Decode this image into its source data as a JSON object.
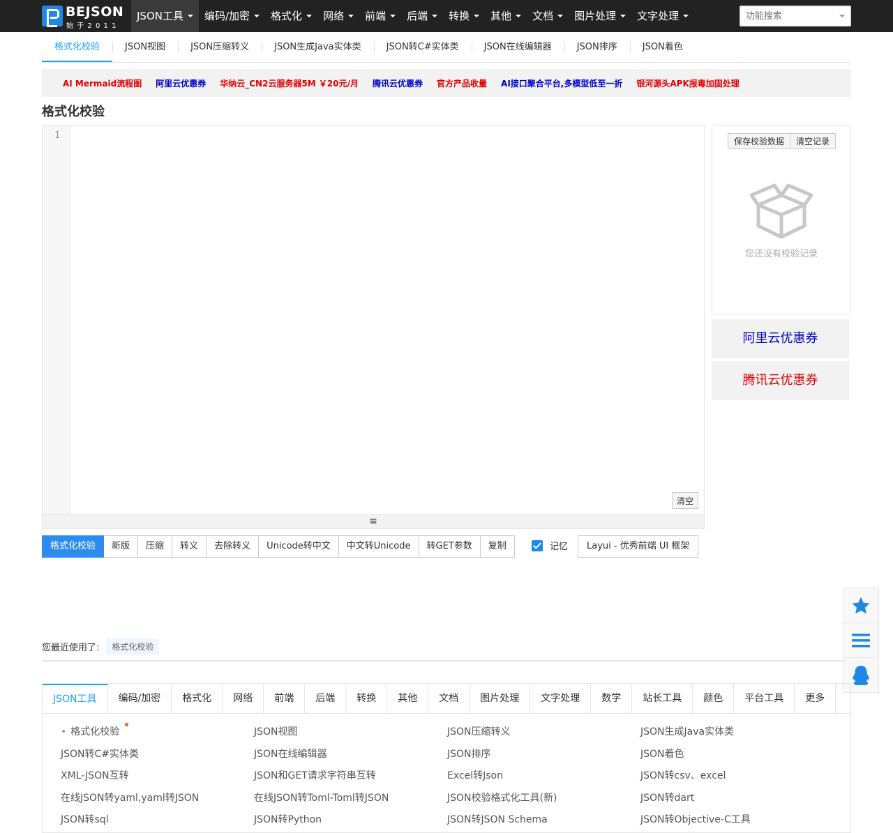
{
  "brand": {
    "name": "BEJSON",
    "since": "始于2011"
  },
  "nav": {
    "items": [
      {
        "label": "JSON工具",
        "active": true
      },
      {
        "label": "编码/加密"
      },
      {
        "label": "格式化"
      },
      {
        "label": "网络"
      },
      {
        "label": "前端"
      },
      {
        "label": "后端"
      },
      {
        "label": "转换"
      },
      {
        "label": "其他"
      },
      {
        "label": "文档"
      },
      {
        "label": "图片处理"
      },
      {
        "label": "文字处理"
      }
    ],
    "search_placeholder": "功能搜索"
  },
  "subtabs": [
    "格式化校验",
    "JSON视图",
    "JSON压缩转义",
    "JSON生成Java实体类",
    "JSON转C#实体类",
    "JSON在线编辑器",
    "JSON排序",
    "JSON着色"
  ],
  "ads": [
    {
      "label": "AI Mermaid流程图",
      "color": "red"
    },
    {
      "label": "阿里云优惠券",
      "color": "blue"
    },
    {
      "label": "华纳云_CN2云服务器5M ￥20元/月",
      "color": "red"
    },
    {
      "label": "腾讯云优惠券",
      "color": "blue"
    },
    {
      "label": "官方产品收量",
      "color": "red"
    },
    {
      "label": "AI接口聚合平台,多模型低至一折",
      "color": "blue"
    },
    {
      "label": "银河源头APK报毒加固处理",
      "color": "red"
    }
  ],
  "page_title": "格式化校验",
  "editor": {
    "line_number": "1",
    "clear_label": "清空"
  },
  "history": {
    "save_label": "保存校验数据",
    "clear_label": "清空记录",
    "empty_text": "您还没有校验记录"
  },
  "promos": [
    {
      "label": "阿里云优惠券",
      "color": "#0000c8"
    },
    {
      "label": "腾讯云优惠券",
      "color": "#e10000"
    }
  ],
  "actions": [
    "格式化校验",
    "新版",
    "压缩",
    "转义",
    "去除转义",
    "Unicode转中文",
    "中文转Unicode",
    "转GET参数",
    "复制"
  ],
  "memory_label": "记忆",
  "layui_label": "Layui - 优秀前端 UI 框架",
  "recent": {
    "label": "您最近使用了:",
    "items": [
      "格式化校验"
    ]
  },
  "category_tabs": [
    "JSON工具",
    "编码/加密",
    "格式化",
    "网络",
    "前端",
    "后端",
    "转换",
    "其他",
    "文档",
    "图片处理",
    "文字处理",
    "数学",
    "站长工具",
    "颜色",
    "平台工具",
    "更多"
  ],
  "tool_links": [
    "格式化校验",
    "JSON视图",
    "JSON压缩转义",
    "JSON生成Java实体类",
    "JSON转C#实体类",
    "JSON在线编辑器",
    "JSON排序",
    "JSON着色",
    "XML-JSON互转",
    "JSON和GET请求字符串互转",
    "Excel转Json",
    "JSON转csv、excel",
    "在线JSON转yaml,yaml转JSON",
    "在线JSON转Toml-Toml转JSON",
    "JSON校验格式化工具(新)",
    "JSON转dart",
    "JSON转sql",
    "JSON转Python",
    "JSON转JSON Schema",
    "JSON转Objective-C工具"
  ],
  "colors": {
    "accent": "#1e9fff",
    "primary_button": "#2d8cf0",
    "nav_bg": "#222222"
  }
}
